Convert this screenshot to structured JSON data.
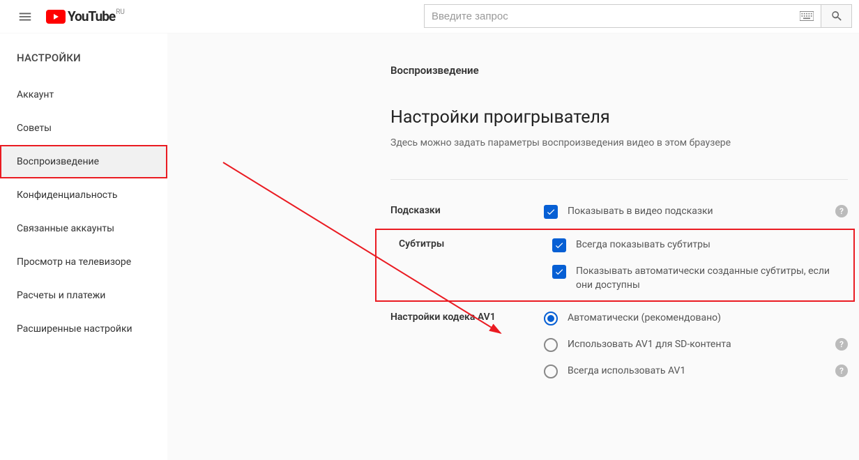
{
  "header": {
    "brand": "YouTube",
    "region": "RU",
    "search_placeholder": "Введите запрос"
  },
  "sidebar": {
    "title": "НАСТРОЙКИ",
    "items": [
      {
        "label": "Аккаунт"
      },
      {
        "label": "Советы"
      },
      {
        "label": "Воспроизведение"
      },
      {
        "label": "Конфиденциальность"
      },
      {
        "label": "Связанные аккаунты"
      },
      {
        "label": "Просмотр на телевизоре"
      },
      {
        "label": "Расчеты и платежи"
      },
      {
        "label": "Расширенные настройки"
      }
    ],
    "active_index": 2
  },
  "main": {
    "breadcrumb": "Воспроизведение",
    "title": "Настройки проигрывателя",
    "description": "Здесь можно задать параметры воспроизведения видео в этом браузере",
    "groups": {
      "hints": {
        "head": "Подсказки",
        "options": [
          {
            "label": "Показывать в видео подсказки",
            "checked": true,
            "has_help": true
          }
        ]
      },
      "subtitles": {
        "head": "Субтитры",
        "options": [
          {
            "label": "Всегда показывать субтитры",
            "checked": true
          },
          {
            "label": "Показывать автоматически созданные субтитры, если они доступны",
            "checked": true
          }
        ]
      },
      "av1": {
        "head": "Настройки кодека AV1",
        "options": [
          {
            "label": "Автоматически (рекомендовано)",
            "checked": true
          },
          {
            "label": "Использовать AV1 для SD-контента",
            "checked": false,
            "has_help": true
          },
          {
            "label": "Всегда использовать AV1",
            "checked": false,
            "has_help": true
          }
        ]
      }
    }
  }
}
